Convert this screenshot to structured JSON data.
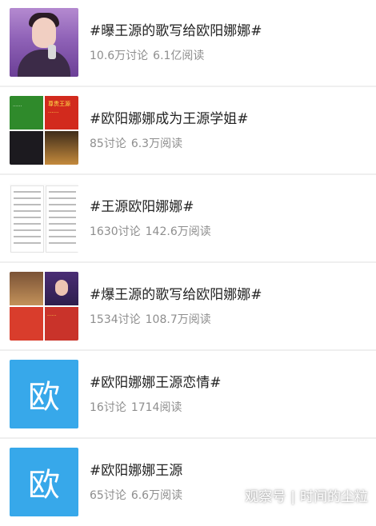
{
  "topics": [
    {
      "title": "#曝王源的歌写给欧阳娜娜#",
      "discussions": "10.6万讨论",
      "reads": "6.1亿阅读",
      "thumbnail": "singer-portrait"
    },
    {
      "title": "#欧阳娜娜成为王源学姐#",
      "discussions": "85讨论",
      "reads": "6.3万阅读",
      "thumbnail": "photo-collage"
    },
    {
      "title": "#王源欧阳娜娜#",
      "discussions": "1630讨论",
      "reads": "142.6万阅读",
      "thumbnail": "document-scan"
    },
    {
      "title": "#爆王源的歌写给欧阳娜娜#",
      "discussions": "1534讨论",
      "reads": "108.7万阅读",
      "thumbnail": "photo-collage"
    },
    {
      "title": "#欧阳娜娜王源恋情#",
      "discussions": "16讨论",
      "reads": "1714阅读",
      "thumbnail": "text-tile",
      "thumbnail_text": "欧",
      "thumbnail_color": "#37a8ea"
    },
    {
      "title": "#欧阳娜娜王源",
      "discussions": "65讨论",
      "reads": "6.6万阅读",
      "thumbnail": "text-tile",
      "thumbnail_text": "欧",
      "thumbnail_color": "#37a8ea"
    }
  ],
  "watermark": {
    "brand": "观察号",
    "author": "时间的尘粒"
  },
  "thumb_text": {
    "green": "......",
    "red": "尊贵王源 ......",
    "collage": "......"
  }
}
